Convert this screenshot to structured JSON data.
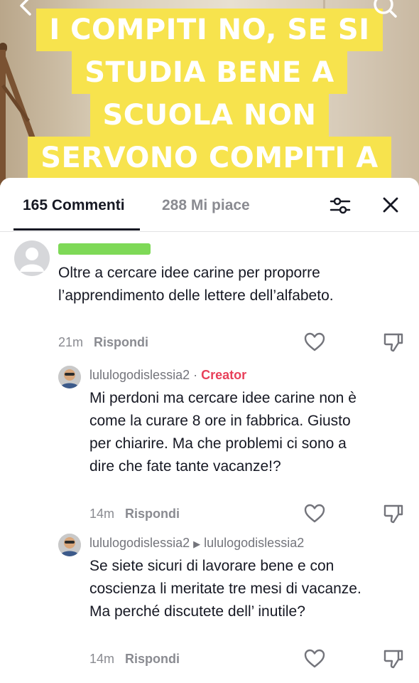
{
  "video": {
    "overlay_lines": [
      "I COMPITI NO, SE SI",
      "STUDIA BENE A",
      "SCUOLA NON",
      "SERVONO COMPITI A"
    ]
  },
  "tabs": {
    "comments": "165 Commenti",
    "likes": "288 Mi piace"
  },
  "comments": [
    {
      "text": "Oltre a cercare idee carine per proporre l’apprendimento delle lettere dell’alfabeto.",
      "time": "21m",
      "reply_label": "Rispondi"
    }
  ],
  "replies": [
    {
      "username": "lululogodislessia2",
      "separator": "·",
      "badge": "Creator",
      "text": "Mi perdoni ma cercare idee carine non è come la curare 8 ore in fabbrica. Giusto per chiarire. Ma che problemi ci sono a dire che fate tante vacanze!?",
      "time": "14m",
      "reply_label": "Rispondi"
    },
    {
      "username": "lululogodislessia2",
      "reply_to": "lululogodislessia2",
      "text": "Se siete sicuri di lavorare bene e con coscienza li meritate tre mesi di vacanze. Ma perché discutete dell’ inutile?",
      "time": "14m",
      "reply_label": "Rispondi"
    }
  ],
  "icons": {
    "back": "chevron-left-icon",
    "search": "search-icon",
    "filter": "sliders-icon",
    "close": "close-icon",
    "like": "heart-icon",
    "dislike": "thumbs-down-icon"
  },
  "colors": {
    "overlay_highlight": "#f7e34d",
    "creator_badge": "#e8405a",
    "redaction": "#7ed957"
  }
}
